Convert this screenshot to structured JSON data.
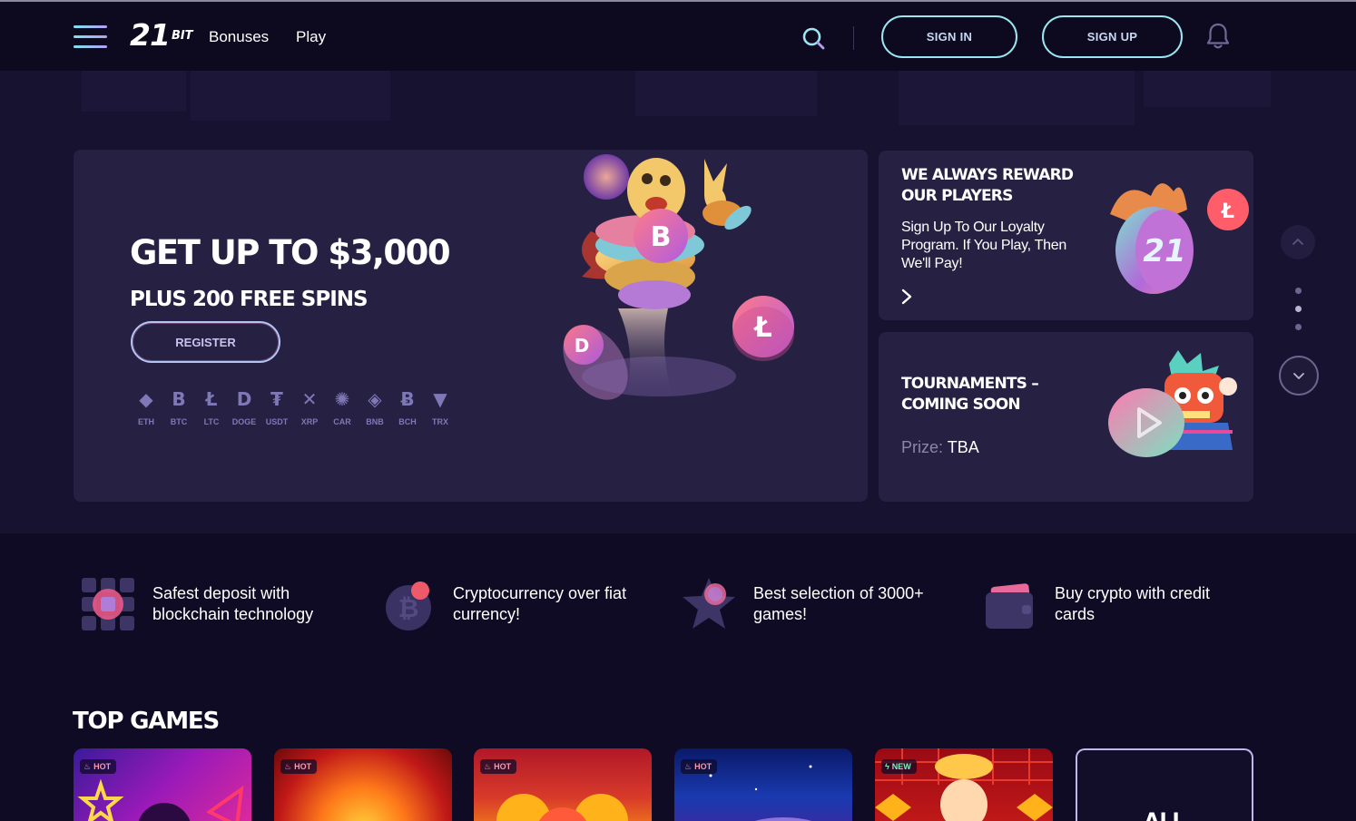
{
  "header": {
    "logo_main": "21",
    "logo_sub": "BIT",
    "nav": [
      "Bonuses",
      "Play"
    ],
    "sign_in": "SIGN IN",
    "sign_up": "SIGN UP"
  },
  "hero": {
    "title": "GET UP TO $3,000",
    "subtitle": "PLUS 200 FREE SPINS",
    "register": "REGISTER",
    "cryptos": [
      {
        "name": "ETH",
        "glyph": "◆"
      },
      {
        "name": "BTC",
        "glyph": "B"
      },
      {
        "name": "LTC",
        "glyph": "Ł"
      },
      {
        "name": "DOGE",
        "glyph": "D"
      },
      {
        "name": "USDT",
        "glyph": "₮"
      },
      {
        "name": "XRP",
        "glyph": "✕"
      },
      {
        "name": "CAR",
        "glyph": "✺"
      },
      {
        "name": "BNB",
        "glyph": "◈"
      },
      {
        "name": "BCH",
        "glyph": "Ƀ"
      },
      {
        "name": "TRX",
        "glyph": "▼"
      }
    ]
  },
  "loyalty": {
    "title": "WE ALWAYS REWARD OUR PLAYERS",
    "text": "Sign Up To Our Loyalty Program. If You Play, Then We'll Pay!"
  },
  "tournaments": {
    "title": "TOURNAMENTS – COMING SOON",
    "prize_label": "Prize:",
    "prize_value": "TBA"
  },
  "features": [
    {
      "text": "Safest deposit with blockchain technology",
      "icon": "blockchain-icon"
    },
    {
      "text": "Cryptocurrency over fiat currency!",
      "icon": "bitcoin-icon"
    },
    {
      "text": "Best selection of 3000+ games!",
      "icon": "star-icon"
    },
    {
      "text": "Buy crypto with credit cards",
      "icon": "wallet-icon"
    }
  ],
  "top_games": {
    "title": "TOP GAMES",
    "badges": [
      "HOT",
      "HOT",
      "HOT",
      "HOT",
      "NEW"
    ],
    "all_label": "ALL"
  },
  "colors": {
    "background": "#0f0b24",
    "card": "#262043",
    "accent_cyan": "#9ce6f2",
    "muted_icon": "#7f78b7"
  }
}
